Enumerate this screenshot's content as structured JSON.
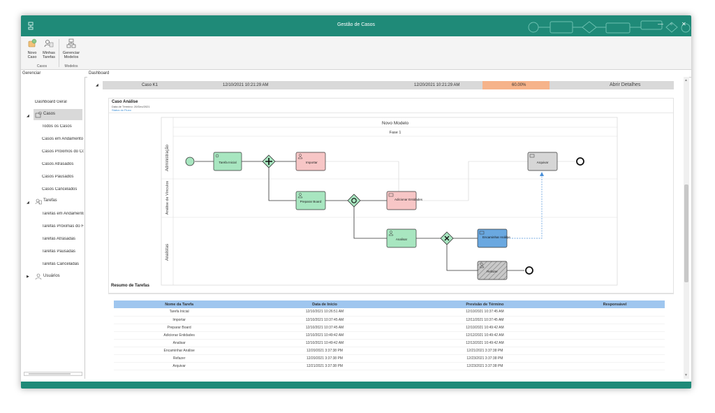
{
  "window": {
    "title": "Gestão de Casos"
  },
  "ribbon": {
    "buttons": [
      {
        "label1": "Novo",
        "label2": "Caso"
      },
      {
        "label1": "Minhas",
        "label2": "Tarefas"
      },
      {
        "label1": "Gerenciar",
        "label2": "Modelos"
      }
    ],
    "groups": [
      "Casos",
      "Modelos"
    ]
  },
  "panels": {
    "left_header": "Gerenciar",
    "main_tab": "Dashboard"
  },
  "sidebar": {
    "dashboard": "Dashboard Geral",
    "casos": {
      "label": "Casos",
      "items": [
        "Todos os Casos",
        "Casos em Andamento",
        "Casos Próximos do Conclusão",
        "Casos Atrasados",
        "Casos Pausados",
        "Casos Cancelados"
      ]
    },
    "tarefas": {
      "label": "Tarefas",
      "items": [
        "Tarefas em Andamento",
        "Tarefas Próximas do Fim",
        "Tarefas Atrasadas",
        "Tarefas Pausadas",
        "Tarefas Canceladas"
      ]
    },
    "usuarios": "Usuários"
  },
  "case_row": {
    "name": "Caso K1",
    "start": "12/10/2021 10:21:29 AM",
    "end": "12/20/2021 10:21:29 AM",
    "progress_text": "60.00%",
    "progress_value": 0.6,
    "action": "Abrir Detalhes"
  },
  "case_detail": {
    "title": "Caso Análise",
    "deadline": "Data de Término: 20/Dec/2021",
    "link": "Status do Fluxo"
  },
  "diagram": {
    "model_title": "Novo Modelo",
    "phase": "Fase 1",
    "lanes": [
      "Administração",
      "Análise de Vínculos",
      "Analistas"
    ],
    "tasks": {
      "tarefa_inicial": "Tarefa Inicial",
      "importar": "Importar",
      "preparar_board": "Preparar Board",
      "adicionar_entidades": "Adicionar Entidades",
      "analisar": "Analisar",
      "encaminhar_analise": "Encaminhar Análise",
      "arquivar": "Arquivar",
      "refazer": "Refazer"
    }
  },
  "summary": {
    "title": "Resumo de Tarefas",
    "columns": [
      "Nome da Tarefa",
      "Data de Início",
      "Previsão de Término",
      "Responsável"
    ],
    "rows": [
      [
        "Tarefa Inicial",
        "12/10/2021 10:26:51 AM",
        "12/10/2021 10:37:45 AM",
        ""
      ],
      [
        "Importar",
        "12/10/2021 10:37:45 AM",
        "12/11/2021 10:37:45 AM",
        ""
      ],
      [
        "Preparar Board",
        "12/10/2021 10:37:45 AM",
        "12/10/2021 10:49:42 AM",
        ""
      ],
      [
        "Adicionar Entidades",
        "12/10/2021 10:49:42 AM",
        "12/12/2021 10:49:42 AM",
        ""
      ],
      [
        "Analisar",
        "12/10/2021 10:49:42 AM",
        "12/13/2021 10:49:42 AM",
        ""
      ],
      [
        "Encaminhar Análise",
        "12/20/2021 3:37:38 PM",
        "12/21/2021 3:37:38 PM",
        ""
      ],
      [
        "Refazer",
        "12/20/2021 3:37:38 PM",
        "12/23/2021 3:37:38 PM",
        ""
      ],
      [
        "Arquivar",
        "12/21/2021 3:37:38 PM",
        "12/23/2021 3:37:38 PM",
        ""
      ]
    ]
  },
  "colors": {
    "accent": "#1f8a78",
    "progress": "#f6b38a",
    "table_header": "#9fc6ef",
    "task_green": "#a8e6c0",
    "task_red": "#f7c6c6",
    "task_blue": "#6aa8e0",
    "task_gray": "#d6d6d6"
  }
}
